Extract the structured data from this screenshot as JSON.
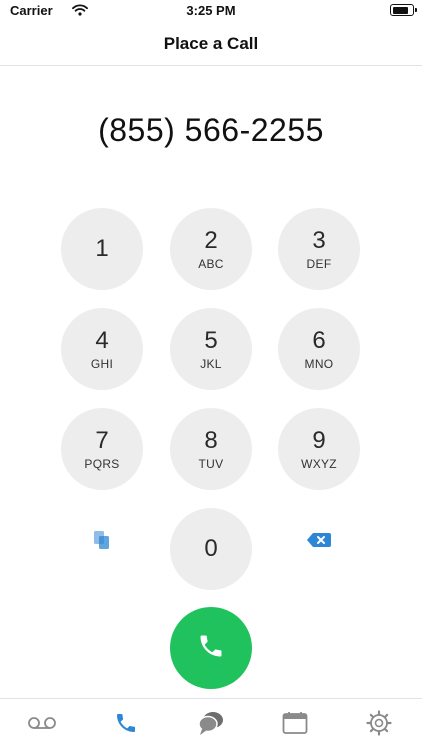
{
  "status_bar": {
    "carrier": "Carrier",
    "time": "3:25 PM"
  },
  "nav": {
    "title": "Place a Call"
  },
  "dialer": {
    "number": "(855) 566-2255"
  },
  "keypad": {
    "keys": [
      {
        "digit": "1",
        "letters": ""
      },
      {
        "digit": "2",
        "letters": "ABC"
      },
      {
        "digit": "3",
        "letters": "DEF"
      },
      {
        "digit": "4",
        "letters": "GHI"
      },
      {
        "digit": "5",
        "letters": "JKL"
      },
      {
        "digit": "6",
        "letters": "MNO"
      },
      {
        "digit": "7",
        "letters": "PQRS"
      },
      {
        "digit": "8",
        "letters": "TUV"
      },
      {
        "digit": "9",
        "letters": "WXYZ"
      },
      {
        "digit": "0",
        "letters": ""
      }
    ]
  },
  "colors": {
    "accent": "#2e86d6",
    "call_green": "#20c25d",
    "key_bg": "#ededed",
    "icon_gray": "#8a8a8a"
  },
  "icons": {
    "paste": "paste-icon",
    "delete": "backspace-icon",
    "call": "phone-icon",
    "tabs": [
      "voicemail-icon",
      "phone-icon",
      "chat-bubble-icon",
      "calendar-icon",
      "gear-icon"
    ]
  },
  "tabs": {
    "active_index": 1
  }
}
